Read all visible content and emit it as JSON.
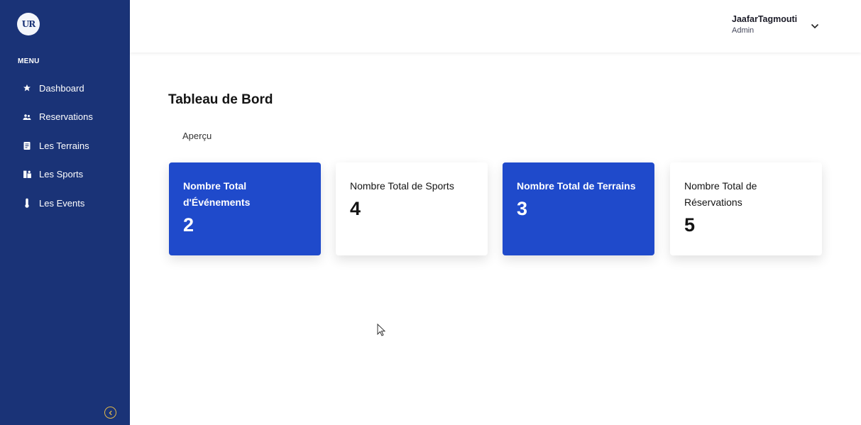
{
  "sidebar": {
    "logo_text": "UR",
    "menu_label": "MENU",
    "items": [
      {
        "label": "Dashboard",
        "icon": "star-icon"
      },
      {
        "label": "Reservations",
        "icon": "users-icon"
      },
      {
        "label": "Les Terrains",
        "icon": "clipboard-icon"
      },
      {
        "label": "Les Sports",
        "icon": "sports-icon"
      },
      {
        "label": "Les Events",
        "icon": "thermometer-icon"
      }
    ],
    "collapse_icon": "chevron-left-circle-icon"
  },
  "header": {
    "user_name": "JaafarTagmouti",
    "user_role": "Admin",
    "dropdown_icon": "chevron-down-icon"
  },
  "main": {
    "title": "Tableau de Bord",
    "tab": "Aperçu",
    "cards": [
      {
        "label_line1": "Nombre Total",
        "label_line2": "d'Événements",
        "value": "2",
        "color": "#1f4acb"
      },
      {
        "label_line1": "Nombre Total de Sports",
        "label_line2": "",
        "value": "4",
        "color": "#ffffff"
      },
      {
        "label_line1": "Nombre Total de Terrains",
        "label_line2": "",
        "value": "3",
        "color": "#1f4acb"
      },
      {
        "label_line1": "Nombre Total de",
        "label_line2": "Réservations",
        "value": "5",
        "color": "#ffffff"
      }
    ]
  },
  "colors": {
    "sidebar_bg": "#1a3377",
    "card_accent": "#1f4acb",
    "collapse_ring": "#e0b84a"
  }
}
